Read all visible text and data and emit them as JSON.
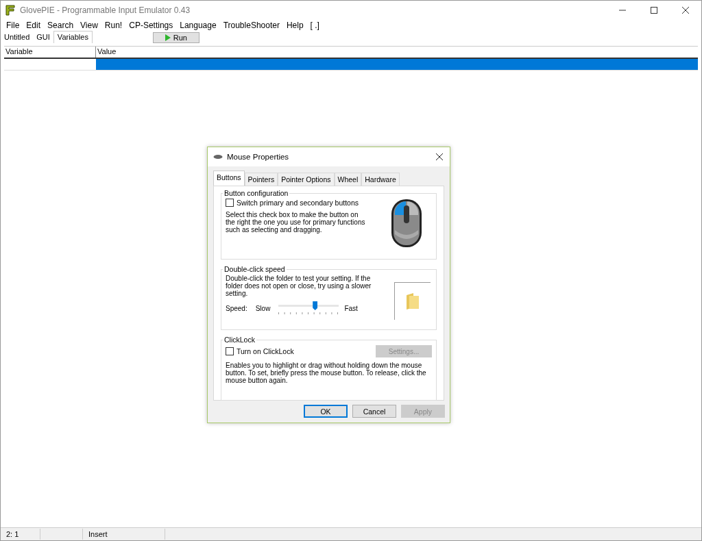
{
  "window": {
    "title": "GlovePIE - Programmable Input Emulator 0.43"
  },
  "menu": [
    "File",
    "Edit",
    "Search",
    "View",
    "Run!",
    "CP-Settings",
    "Language",
    "TroubleShooter",
    "Help",
    "[ .]"
  ],
  "tabs": [
    {
      "label": "Untitled",
      "selected": false
    },
    {
      "label": "GUI",
      "selected": false
    },
    {
      "label": "Variables",
      "selected": true
    }
  ],
  "run_button": "Run",
  "table": {
    "columns": [
      "Variable",
      "Value"
    ],
    "rows": [
      {
        "selected": true
      }
    ]
  },
  "dialog": {
    "title": "Mouse Properties",
    "tabs": [
      {
        "label": "Buttons",
        "selected": true
      },
      {
        "label": "Pointers",
        "selected": false
      },
      {
        "label": "Pointer Options",
        "selected": false
      },
      {
        "label": "Wheel",
        "selected": false
      },
      {
        "label": "Hardware",
        "selected": false
      }
    ],
    "button_configuration": {
      "title": "Button configuration",
      "checkbox": {
        "label": "Switch primary and secondary buttons",
        "checked": false
      },
      "description": "Select this check box to make the button on the right the one you use for primary functions such as selecting and dragging."
    },
    "double_click_speed": {
      "title": "Double-click speed",
      "description": "Double-click the folder to test your setting. If the folder does not open or close, try using a slower setting.",
      "speed_label": "Speed:",
      "slow_label": "Slow",
      "fast_label": "Fast",
      "level": 0.6
    },
    "clicklock": {
      "title": "ClickLock",
      "checkbox": {
        "label": "Turn on ClickLock",
        "checked": false
      },
      "settings_button": {
        "label": "Settings...",
        "disabled": true
      },
      "description": "Enables you to highlight or drag without holding down the mouse button. To set, briefly press the mouse button. To release, click the mouse button again."
    },
    "buttons": [
      {
        "label": "OK",
        "disabled": false,
        "default": true
      },
      {
        "label": "Cancel",
        "disabled": false,
        "default": false
      },
      {
        "label": "Apply",
        "disabled": true,
        "default": false
      }
    ]
  },
  "status_bar": [
    "2: 1",
    "Insert"
  ]
}
